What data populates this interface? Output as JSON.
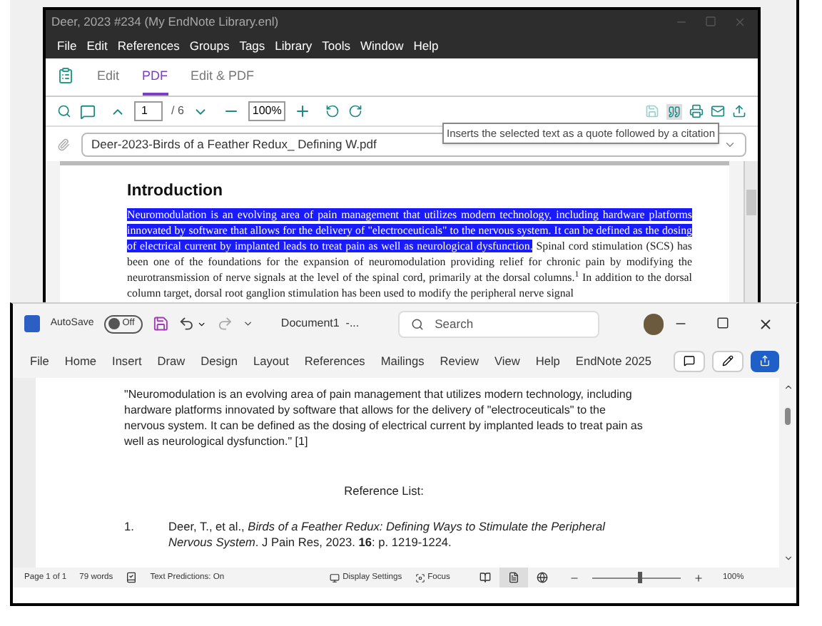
{
  "endnote": {
    "title": "Deer, 2023 #234 (My EndNote Library.enl)",
    "menu": [
      "File",
      "Edit",
      "References",
      "Groups",
      "Tags",
      "Library",
      "Tools",
      "Window",
      "Help"
    ],
    "tabs": [
      {
        "label": "Edit",
        "selected": false
      },
      {
        "label": "PDF",
        "selected": true
      },
      {
        "label": "Edit & PDF",
        "selected": false
      }
    ],
    "toolbar": {
      "page": "1",
      "page_total": "/ 6",
      "zoom": "100%"
    },
    "tooltip": "Inserts the selected text as a quote followed by a citation",
    "file": "Deer-2023-Birds of a Feather Redux_ Defining W.pdf",
    "pdf": {
      "heading": "Introduction",
      "highlighted": "Neuromodulation is an evolving area of pain management that utilizes modern technology, including hardware platforms innovated by software that allows for the delivery of \"electroceuticals\" to the nervous system. It can be defined as the dosing of electrical current by implanted leads to treat pain as well as neurological dysfunction.",
      "body": "Spinal cord stimulation (SCS) has been one of the foundations for the expansion of neuromodulation providing relief for chronic pain by modifying the neurotransmission of nerve signals at the level of the spinal cord, primarily at the dorsal columns.$^{1}$ In addition to the dorsal column target, dorsal root ganglion stimulation has been used to modify the peripheral nerve signal"
    }
  },
  "word": {
    "autosave": {
      "label": "AutoSave",
      "on": false,
      "state": "Off"
    },
    "document_title": "Document1  -...",
    "search": {
      "placeholder": "Search"
    },
    "ribbon_tabs": [
      "File",
      "Home",
      "Insert",
      "Draw",
      "Design",
      "Layout",
      "References",
      "Mailings",
      "Review",
      "View",
      "Help",
      "EndNote 2025"
    ],
    "quote": "\"Neuromodulation is an evolving area of pain management that utilizes modern technology, including hardware platforms innovated by software that allows for the delivery of \"electroceuticals\" to the nervous system. It can be defined as the dosing of electrical current by implanted leads to treat pain as well as neurological dysfunction.\" [1]",
    "reference_heading": "Reference List:",
    "references": [
      {
        "number": "1.",
        "text": "Deer, T., et al., *Birds of a Feather Redux: Defining Ways to Stimulate the Peripheral Nervous System*. J Pain Res, 2023. **16**: p. 1219-1224."
      }
    ],
    "status": {
      "page": "Page 1 of 1",
      "words": "79 words",
      "predictions": "Text Predictions: On",
      "display": "Display Settings",
      "focus": "Focus",
      "zoom": "100%",
      "zoom_level": {
        "level": 0.52
      }
    },
    "views": [
      {
        "kind": "read",
        "selected": false
      },
      {
        "kind": "print",
        "selected": true
      },
      {
        "kind": "web",
        "selected": false
      }
    ]
  }
}
